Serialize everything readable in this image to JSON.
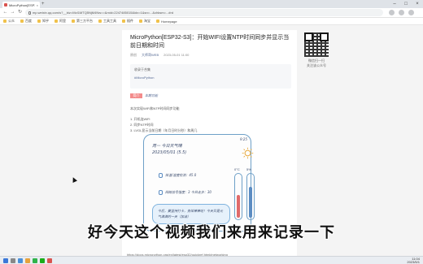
{
  "browser": {
    "tab_title": "MicroPython[ESP32-S3]...",
    "url": "mp.weixin.qq.com/s?__biz=MzI1MTQ5NjM4Nw==&mid=2247485015&idx=1&sn=...&chksm=...#rd",
    "bookmarks": [
      "公众",
      "百度",
      "知乎",
      "阿里",
      "第三方平台",
      "工具工具",
      "插件",
      "淘宝",
      "Homepage"
    ]
  },
  "article": {
    "title": "MicroPython[ESP32-S3]：开始WIFI设置NTP时间同步并显示当前日期和时间",
    "author": "大师哥WEB",
    "date": "2023-05-01 11:00",
    "quote_line": "收录于合集",
    "quote_tag": "#MicroPython",
    "badge": "简介",
    "badge_note": "本期功能",
    "intro": "本次实现WIFI和NTP时间同步功能",
    "list": [
      "1. 开机连WiFi",
      "2. 同步NTP时间",
      "3. LVGL显示当前日期（年月日时分秒）和周几"
    ],
    "link_text": "https://docs.micropython.org/en/latest/esp32/quickref.html#networking"
  },
  "illustration": {
    "day": "周一  今日天气晴",
    "date": "2023/05/01 (5.5)",
    "clock": "9:25",
    "row1": "体温/温度检测：45.0",
    "row2": "网络信号强度：3  今日走步：30",
    "bubble": "今后，要坚持打卡，身体棒棒哒！今天又是元气满满的一天（加油）",
    "therm1_label": "0°C",
    "therm2_label": "5%",
    "therm1_level": 0.55,
    "therm2_level": 0.75
  },
  "qr": {
    "caption": "微信扫一扫\n关注该公众号"
  },
  "subtitle": "好今天这个视频我们来用来记录一下",
  "taskbar": {
    "time": "11:04",
    "date": "2023/5/1"
  },
  "colors": {
    "accent": "#576b95",
    "badge": "#f38b8b",
    "illustration_border": "#6ea0c8",
    "therm_red": "#e06a6a",
    "therm_blue": "#5b8cc2"
  }
}
